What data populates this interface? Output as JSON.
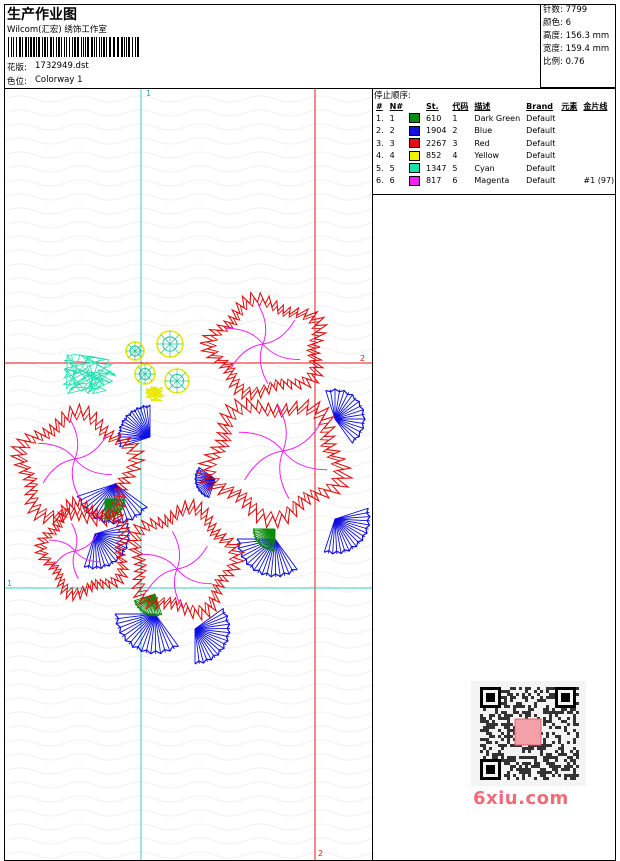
{
  "header": {
    "title": "生产作业图",
    "company": "Wilcom(汇宏) 绣饰工作室",
    "design_label": "花版:",
    "design_file": "1732949.dst",
    "colorway_label": "色位:",
    "colorway": "Colorway 1"
  },
  "stats": {
    "stitches": "针数: 7799",
    "colors": "颜色: 6",
    "height": "高度: 156.3 mm",
    "width": "宽度: 159.4 mm",
    "scale": "比例: 0.76"
  },
  "stop_sequence": {
    "title": "停止顺序:",
    "headers": [
      "#",
      "N#",
      "St.",
      "代码",
      "描述",
      "Brand",
      "元素",
      "金片线"
    ],
    "rows": [
      {
        "idx": "1.",
        "n": "1",
        "color": "#0a8c0a",
        "st": "610",
        "code": "1",
        "desc": "Dark Green",
        "brand": "Default",
        "extra": ""
      },
      {
        "idx": "2.",
        "n": "2",
        "color": "#1010e0",
        "st": "1904",
        "code": "2",
        "desc": "Blue",
        "brand": "Default",
        "extra": ""
      },
      {
        "idx": "3.",
        "n": "3",
        "color": "#e01010",
        "st": "2267",
        "code": "3",
        "desc": "Red",
        "brand": "Default",
        "extra": ""
      },
      {
        "idx": "4.",
        "n": "4",
        "color": "#f0f000",
        "st": "852",
        "code": "4",
        "desc": "Yellow",
        "brand": "Default",
        "extra": ""
      },
      {
        "idx": "5.",
        "n": "5",
        "color": "#20e0b0",
        "st": "1347",
        "code": "5",
        "desc": "Cyan",
        "brand": "Default",
        "extra": ""
      },
      {
        "idx": "6.",
        "n": "6",
        "color": "#f020f0",
        "st": "817",
        "code": "6",
        "desc": "Magenta",
        "brand": "Default",
        "extra": "#1 (97)"
      }
    ]
  },
  "guides": {
    "v1_label": "1",
    "h2_label": "2",
    "h1_label": "1",
    "v2_label": "2"
  },
  "colors": {
    "guide_cyan": "#30d0c0",
    "guide_red": "#e01818"
  },
  "watermark": "6xiu.com"
}
